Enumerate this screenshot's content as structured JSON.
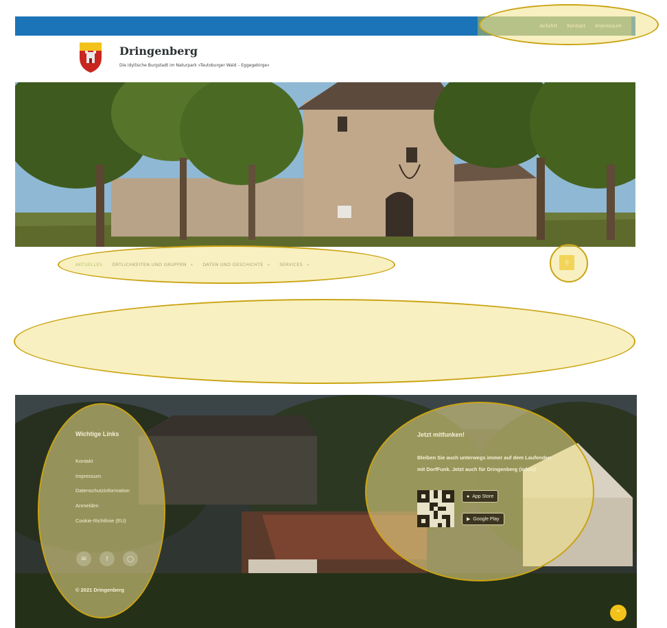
{
  "topbar": {
    "links": [
      "Anfahrt",
      "Kontakt",
      "Impressum"
    ]
  },
  "header": {
    "title": "Dringenberg",
    "tagline": "Die idyllische Burgstadt im Naturpark »Teutoburger Wald – Eggegebirge«"
  },
  "nav": {
    "items": [
      "AKTUELLES",
      "ÖRTLICHKEITEN UND GRUPPEN",
      "DATEN UND GESCHICHTE",
      "SERVICES"
    ],
    "active_index": 0,
    "search_icon": "search-icon"
  },
  "footer": {
    "links_heading": "Wichtige Links",
    "links": [
      "Kontakt",
      "Impressum",
      "Datenschutzinformation",
      "Anmelden",
      "Cookie-Richtlinie (EU)"
    ],
    "social_icons": [
      "mail-icon",
      "facebook-icon",
      "instagram-icon"
    ],
    "copyright": "© 2021 Dringenberg",
    "app_heading": "Jetzt mitfunken!",
    "app_text_line1": "Bleiben Sie auch unterwegs immer auf dem Laufenden",
    "app_text_line2": "mit DorfFunk. Jetzt auch für Dringenberg (infos)!",
    "app_store_label": "App Store",
    "google_play_label": "Google Play"
  },
  "colors": {
    "topbar": "#1b74b8",
    "accent_yellow": "#f2c21a",
    "nav_active": "#6d9f49"
  }
}
